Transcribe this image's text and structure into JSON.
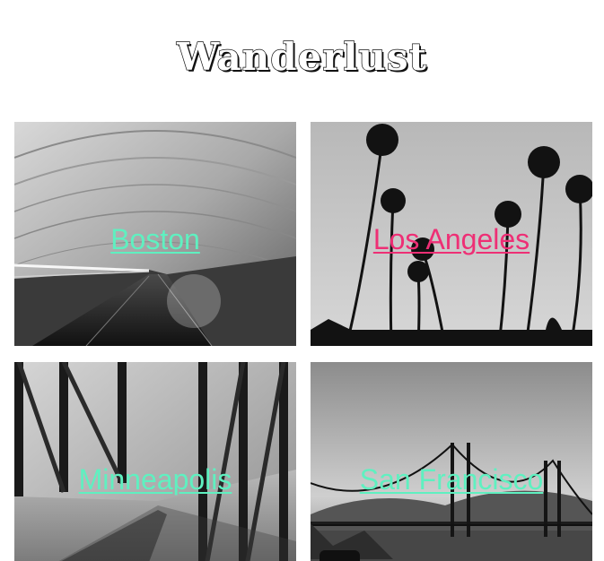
{
  "site": {
    "title": "Wanderlust"
  },
  "cities": [
    {
      "name": "Boston",
      "color": "#5ff0c0"
    },
    {
      "name": "Los Angeles",
      "color": "#ee2f75"
    },
    {
      "name": "Minneapolis",
      "color": "#5ff0c0"
    },
    {
      "name": "San Francisco",
      "color": "#5ff0c0"
    }
  ]
}
